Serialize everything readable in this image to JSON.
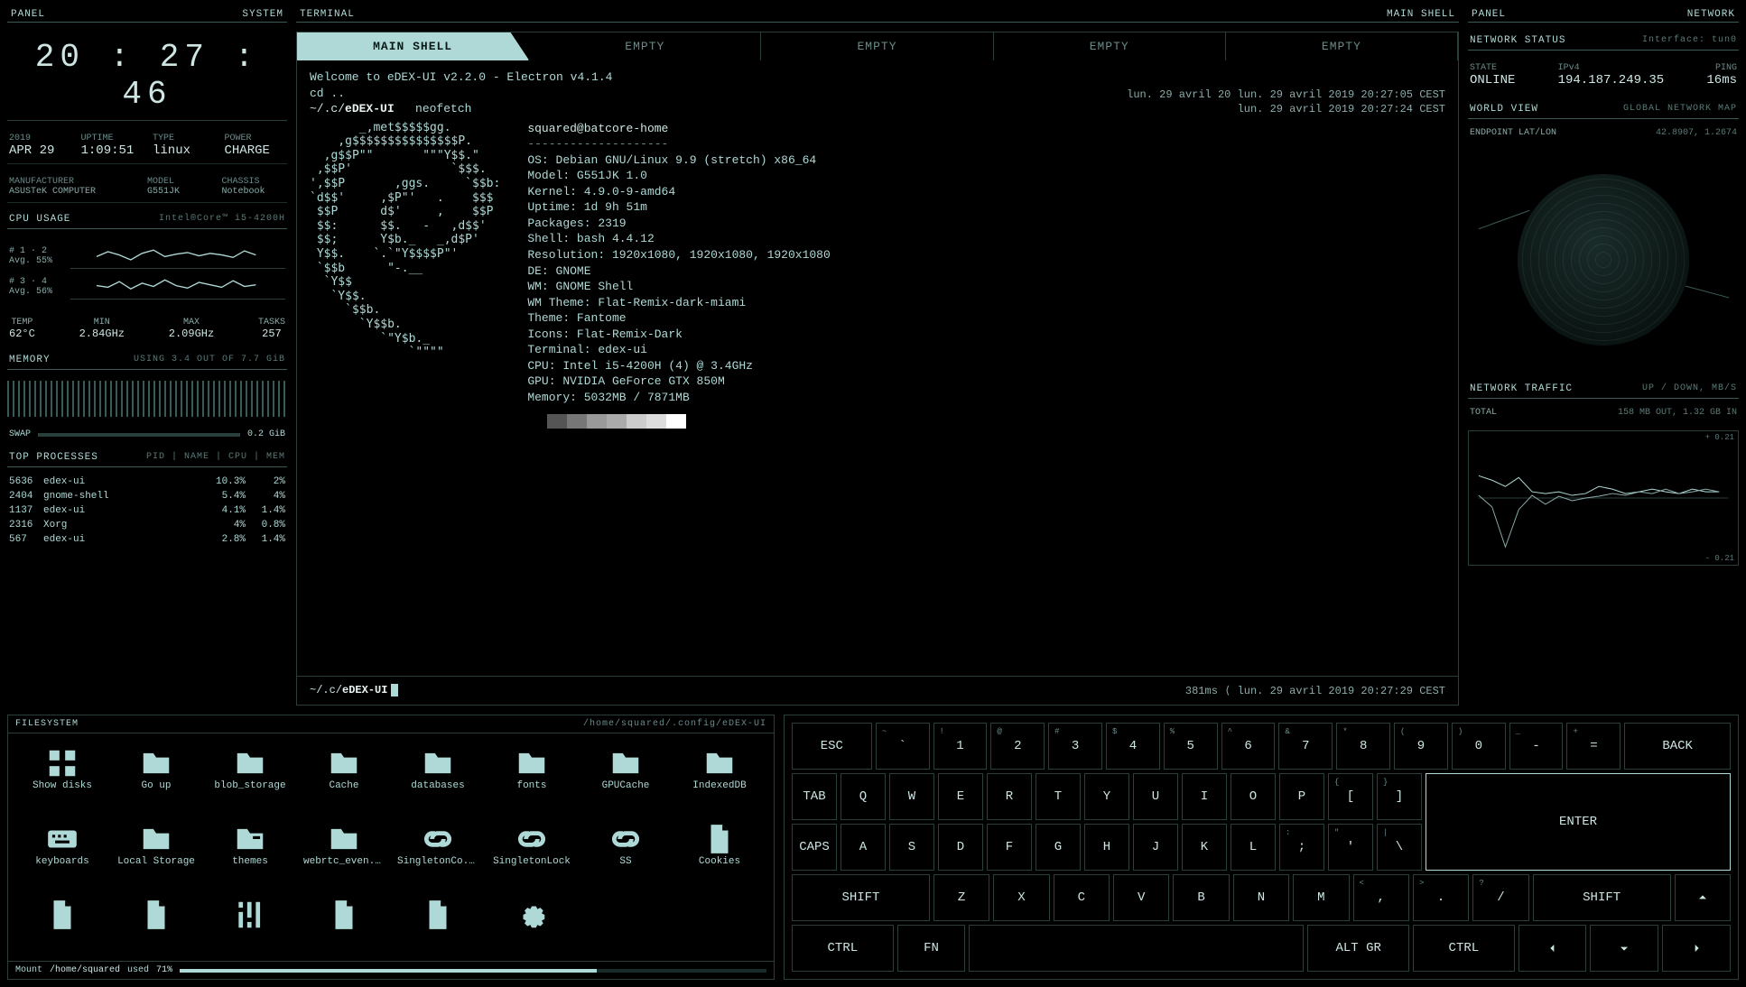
{
  "header": {
    "left_panel": "PANEL",
    "left_system": "SYSTEM",
    "center_terminal": "TERMINAL",
    "center_mainshell": "MAIN SHELL",
    "right_panel": "PANEL",
    "right_network": "NETWORK"
  },
  "clock": "20 : 27 : 46",
  "date": {
    "year": "2019",
    "day": "APR 29"
  },
  "uptime": {
    "label": "UPTIME",
    "value": "1:09:51"
  },
  "type": {
    "label": "TYPE",
    "value": "linux"
  },
  "power": {
    "label": "POWER",
    "value": "CHARGE"
  },
  "mfr": {
    "label": "MANUFACTURER",
    "value": "ASUSTeK COMPUTER"
  },
  "model": {
    "label": "MODEL",
    "value": "G551JK"
  },
  "chassis": {
    "label": "CHASSIS",
    "value": "Notebook"
  },
  "cpu": {
    "title": "CPU USAGE",
    "sub": "Intel®Core™ i5-4200H",
    "core12_label": "# 1 · 2",
    "core12_avg": "Avg. 55%",
    "core34_label": "# 3 · 4",
    "core34_avg": "Avg. 56%",
    "temp_label": "TEMP",
    "temp": "62°C",
    "min_label": "MIN",
    "min": "2.84GHz",
    "max_label": "MAX",
    "max": "2.09GHz",
    "tasks_label": "TASKS",
    "tasks": "257"
  },
  "memory": {
    "title": "MEMORY",
    "sub": "USING 3.4 OUT OF 7.7 GiB",
    "swap_label": "SWAP",
    "swap_value": "0.2 GiB"
  },
  "processes": {
    "title": "TOP PROCESSES",
    "cols": "PID | NAME | CPU | MEM",
    "rows": [
      {
        "pid": "5636",
        "name": "edex-ui",
        "cpu": "10.3%",
        "mem": "2%"
      },
      {
        "pid": "2404",
        "name": "gnome-shell",
        "cpu": "5.4%",
        "mem": "4%"
      },
      {
        "pid": "1137",
        "name": "edex-ui",
        "cpu": "4.1%",
        "mem": "1.4%"
      },
      {
        "pid": "2316",
        "name": "Xorg",
        "cpu": "4%",
        "mem": "0.8%"
      },
      {
        "pid": "567",
        "name": "edex-ui",
        "cpu": "2.8%",
        "mem": "1.4%"
      }
    ]
  },
  "tabs": [
    "MAIN SHELL",
    "EMPTY",
    "EMPTY",
    "EMPTY",
    "EMPTY"
  ],
  "term": {
    "welcome": "Welcome to eDEX-UI v2.2.0 - Electron v4.1.4",
    "cd": "cd ..",
    "prompt_path": "~/.c/eDEX-UI",
    "cmd": "neofetch",
    "right1": "lun. 29 avril 20 lun. 29 avril 2019 20:27:05 CEST",
    "right2": "lun. 29 avril 2019 20:27:24 CEST",
    "prompt_delay": "381ms",
    "prompt_sep": "⟨",
    "prompt_time": "lun. 29 avril 2019 20:27:29 CEST"
  },
  "neofetch": {
    "user": "squared@batcore-home",
    "divider": "--------------------",
    "lines": [
      "OS: Debian GNU/Linux 9.9 (stretch) x86_64",
      "Model: G551JK 1.0",
      "Kernel: 4.9.0-9-amd64",
      "Uptime: 1d 9h 51m",
      "Packages: 2319",
      "Shell: bash 4.4.12",
      "Resolution: 1920x1080, 1920x1080, 1920x1080",
      "DE: GNOME",
      "WM: GNOME Shell",
      "WM Theme: Flat-Remix-dark-miami",
      "Theme: Fantome",
      "Icons: Flat-Remix-Dark",
      "Terminal: edex-ui",
      "CPU: Intel i5-4200H (4) @ 3.4GHz",
      "GPU: NVIDIA GeForce GTX 850M",
      "Memory: 5032MB / 7871MB"
    ],
    "swatches": [
      "#000000",
      "#555555",
      "#777777",
      "#999999",
      "#aaaaaa",
      "#cccccc",
      "#dddddd",
      "#ffffff"
    ]
  },
  "network": {
    "status_title": "NETWORK STATUS",
    "iface": "Interface: tun0",
    "state_label": "STATE",
    "state": "ONLINE",
    "ip_label": "IPv4",
    "ip": "194.187.249.35",
    "ping_label": "PING",
    "ping": "16ms",
    "world_title": "WORLD VIEW",
    "world_sub": "GLOBAL NETWORK MAP",
    "endpoint_label": "ENDPOINT LAT/LON",
    "endpoint": "42.8907, 1.2674",
    "traffic_title": "NETWORK TRAFFIC",
    "traffic_sub": "UP / DOWN, MB/S",
    "total_label": "TOTAL",
    "total": "158 MB OUT, 1.32 GB IN",
    "ymax": "+ 0.21",
    "ymin": "- 0.21"
  },
  "fs": {
    "title": "FILESYSTEM",
    "path": "/home/squared/.config/eDEX-UI",
    "mount_label": "Mount",
    "mount_path": "/home/squared",
    "used_label": "used",
    "used_pct": "71%",
    "items": [
      {
        "name": "Show disks",
        "icon": "disks"
      },
      {
        "name": "Go up",
        "icon": "folder"
      },
      {
        "name": "blob_storage",
        "icon": "folder"
      },
      {
        "name": "Cache",
        "icon": "folder"
      },
      {
        "name": "databases",
        "icon": "folder"
      },
      {
        "name": "fonts",
        "icon": "folder"
      },
      {
        "name": "GPUCache",
        "icon": "folder"
      },
      {
        "name": "IndexedDB",
        "icon": "folder"
      },
      {
        "name": "keyboards",
        "icon": "keyboard"
      },
      {
        "name": "Local Storage",
        "icon": "folder"
      },
      {
        "name": "themes",
        "icon": "folder-brush"
      },
      {
        "name": "webrtc_even...",
        "icon": "folder"
      },
      {
        "name": "SingletonCo...",
        "icon": "link"
      },
      {
        "name": "SingletonLock",
        "icon": "link"
      },
      {
        "name": "SS",
        "icon": "link"
      },
      {
        "name": "Cookies",
        "icon": "file"
      },
      {
        "name": "",
        "icon": "file"
      },
      {
        "name": "",
        "icon": "file"
      },
      {
        "name": "",
        "icon": "sliders"
      },
      {
        "name": "",
        "icon": "file"
      },
      {
        "name": "",
        "icon": "file"
      },
      {
        "name": "",
        "icon": "gear"
      }
    ]
  },
  "keyboard": {
    "row1": [
      {
        "main": "ESC"
      },
      {
        "sup": "~",
        "main": "`"
      },
      {
        "sup": "!",
        "main": "1"
      },
      {
        "sup": "@",
        "main": "2"
      },
      {
        "sup": "#",
        "main": "3"
      },
      {
        "sup": "$",
        "main": "4"
      },
      {
        "sup": "%",
        "main": "5"
      },
      {
        "sup": "^",
        "main": "6"
      },
      {
        "sup": "&",
        "main": "7"
      },
      {
        "sup": "*",
        "main": "8"
      },
      {
        "sup": "(",
        "main": "9"
      },
      {
        "sup": ")",
        "main": "0"
      },
      {
        "sup": "_",
        "main": "-"
      },
      {
        "sup": "+",
        "main": "="
      },
      {
        "main": "BACK"
      }
    ],
    "row2": [
      {
        "main": "TAB"
      },
      {
        "main": "Q"
      },
      {
        "main": "W"
      },
      {
        "main": "E"
      },
      {
        "main": "R"
      },
      {
        "main": "T"
      },
      {
        "main": "Y"
      },
      {
        "main": "U"
      },
      {
        "main": "I"
      },
      {
        "main": "O"
      },
      {
        "main": "P"
      },
      {
        "sup": "{",
        "main": "["
      },
      {
        "sup": "}",
        "main": "]"
      }
    ],
    "enter": "ENTER",
    "row3": [
      {
        "main": "CAPS"
      },
      {
        "main": "A"
      },
      {
        "main": "S"
      },
      {
        "main": "D"
      },
      {
        "main": "F"
      },
      {
        "main": "G"
      },
      {
        "main": "H"
      },
      {
        "main": "J"
      },
      {
        "main": "K"
      },
      {
        "main": "L"
      },
      {
        "sup": ":",
        "main": ";"
      },
      {
        "sup": "\"",
        "main": "'"
      },
      {
        "sup": "|",
        "main": "\\"
      }
    ],
    "row4": [
      {
        "main": "SHIFT"
      },
      {
        "main": "Z"
      },
      {
        "main": "X"
      },
      {
        "main": "C"
      },
      {
        "main": "V"
      },
      {
        "main": "B"
      },
      {
        "main": "N"
      },
      {
        "main": "M"
      },
      {
        "sup": "<",
        "main": ","
      },
      {
        "sup": ">",
        "main": "."
      },
      {
        "sup": "?",
        "main": "/"
      },
      {
        "main": "SHIFT"
      }
    ],
    "row5": {
      "ctrl": "CTRL",
      "fn": "FN",
      "altgr": "ALT GR",
      "ctrl2": "CTRL"
    }
  },
  "chart_data": [
    {
      "type": "line",
      "title": "CPU Core #1·2",
      "ylim": [
        0,
        100
      ],
      "values": [
        48,
        62,
        55,
        40,
        58,
        65,
        50,
        56,
        60,
        52,
        58,
        55,
        50,
        62,
        55
      ]
    },
    {
      "type": "line",
      "title": "CPU Core #3·4",
      "ylim": [
        0,
        100
      ],
      "values": [
        55,
        50,
        68,
        45,
        60,
        52,
        70,
        55,
        48,
        62,
        56,
        50,
        65,
        54,
        56
      ]
    },
    {
      "type": "line",
      "title": "Network Traffic",
      "ylabel": "MB/s",
      "ylim": [
        -0.21,
        0.21
      ],
      "series": [
        {
          "name": "up",
          "values": [
            0.1,
            0.08,
            0.05,
            0.09,
            0.04,
            0.03,
            0.04,
            0.02,
            0.03,
            0.06,
            0.05,
            0.03,
            0.04,
            0.05,
            0.04,
            0.03,
            0.05,
            0.04,
            0.04,
            0.03
          ]
        },
        {
          "name": "down",
          "values": [
            0.02,
            -0.05,
            -0.18,
            -0.05,
            0.02,
            -0.04,
            0.01,
            -0.02,
            0.0,
            0.01,
            0.03,
            0.02,
            0.04,
            0.03,
            0.05,
            0.03,
            0.04,
            0.05,
            0.04,
            0.03
          ]
        }
      ]
    }
  ]
}
